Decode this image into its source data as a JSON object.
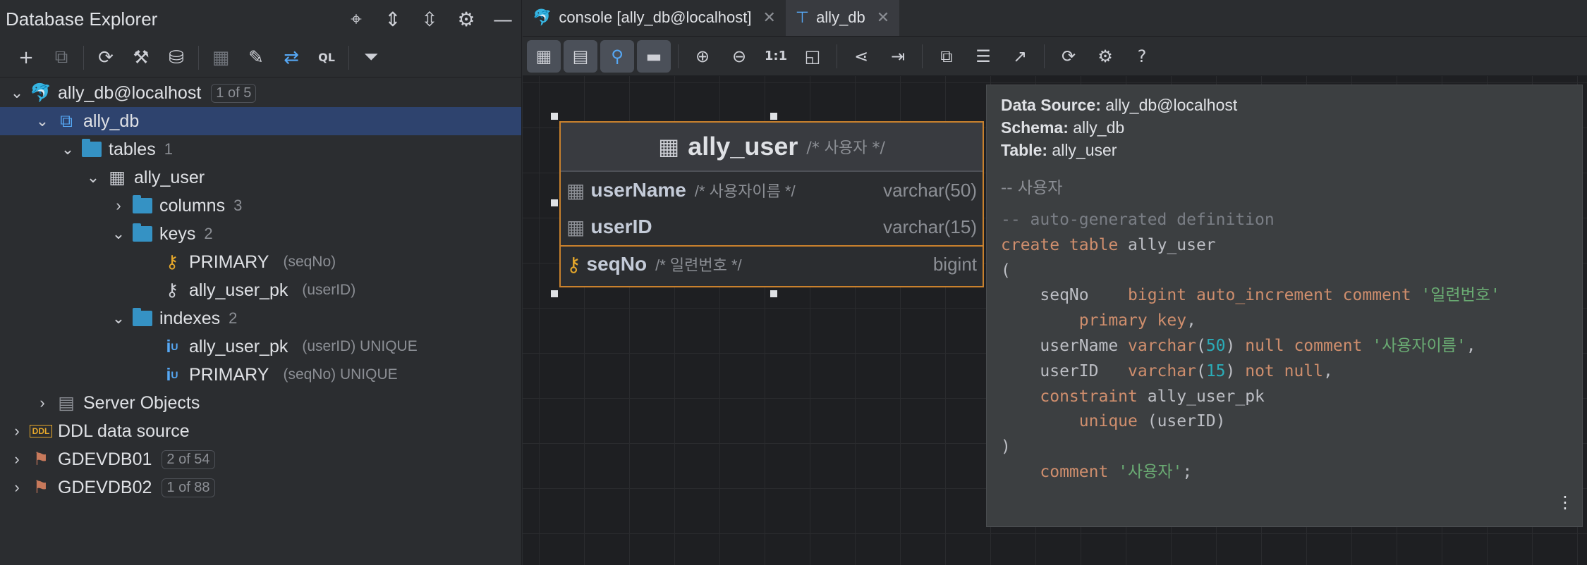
{
  "left": {
    "title": "Database Explorer",
    "header_icons": [
      "crosshair-icon",
      "expand-all-icon",
      "collapse-all-icon",
      "gear-icon",
      "minimize-icon"
    ],
    "toolbar_icons": [
      "add-icon",
      "copy-icon",
      "refresh-icon",
      "settings-icon",
      "datasource-icon",
      "table-icon",
      "edit-icon",
      "jump-icon",
      "ql-icon",
      "filter-icon"
    ],
    "tree": [
      {
        "label": "ally_db@localhost",
        "badge": "1 of 5"
      },
      {
        "label": "ally_db"
      },
      {
        "label": "tables",
        "count": "1"
      },
      {
        "label": "ally_user"
      },
      {
        "label": "columns",
        "count": "3"
      },
      {
        "label": "keys",
        "count": "2"
      },
      {
        "label": "PRIMARY",
        "meta": "(seqNo)"
      },
      {
        "label": "ally_user_pk",
        "meta": "(userID)"
      },
      {
        "label": "indexes",
        "count": "2"
      },
      {
        "label": "ally_user_pk",
        "meta": "(userID) UNIQUE"
      },
      {
        "label": "PRIMARY",
        "meta": "(seqNo) UNIQUE"
      },
      {
        "label": "Server Objects"
      },
      {
        "label": "DDL data source"
      },
      {
        "label": "GDEVDB01",
        "badge": "2 of 54"
      },
      {
        "label": "GDEVDB02",
        "badge": "1 of 88"
      }
    ]
  },
  "tabs": [
    {
      "label": "console [ally_db@localhost]"
    },
    {
      "label": "ally_db"
    }
  ],
  "node": {
    "title": "ally_user",
    "comment": "/* 사용자 */",
    "columns": [
      {
        "name": "userName",
        "comment": "/* 사용자이름 */",
        "type": "varchar(50)"
      },
      {
        "name": "userID",
        "comment": "",
        "type": "varchar(15)"
      },
      {
        "name": "seqNo",
        "comment": "/* 일련번호 */",
        "type": "bigint"
      }
    ]
  },
  "tooltip": {
    "ds_label": "Data Source:",
    "ds_value": "ally_db@localhost",
    "schema_label": "Schema:",
    "schema_value": "ally_db",
    "table_label": "Table:",
    "table_value": "ally_user",
    "comment": "-- 사용자"
  },
  "colors": {
    "accent": "#c9812d",
    "selection": "#2e436e",
    "folder": "#3592c4"
  }
}
